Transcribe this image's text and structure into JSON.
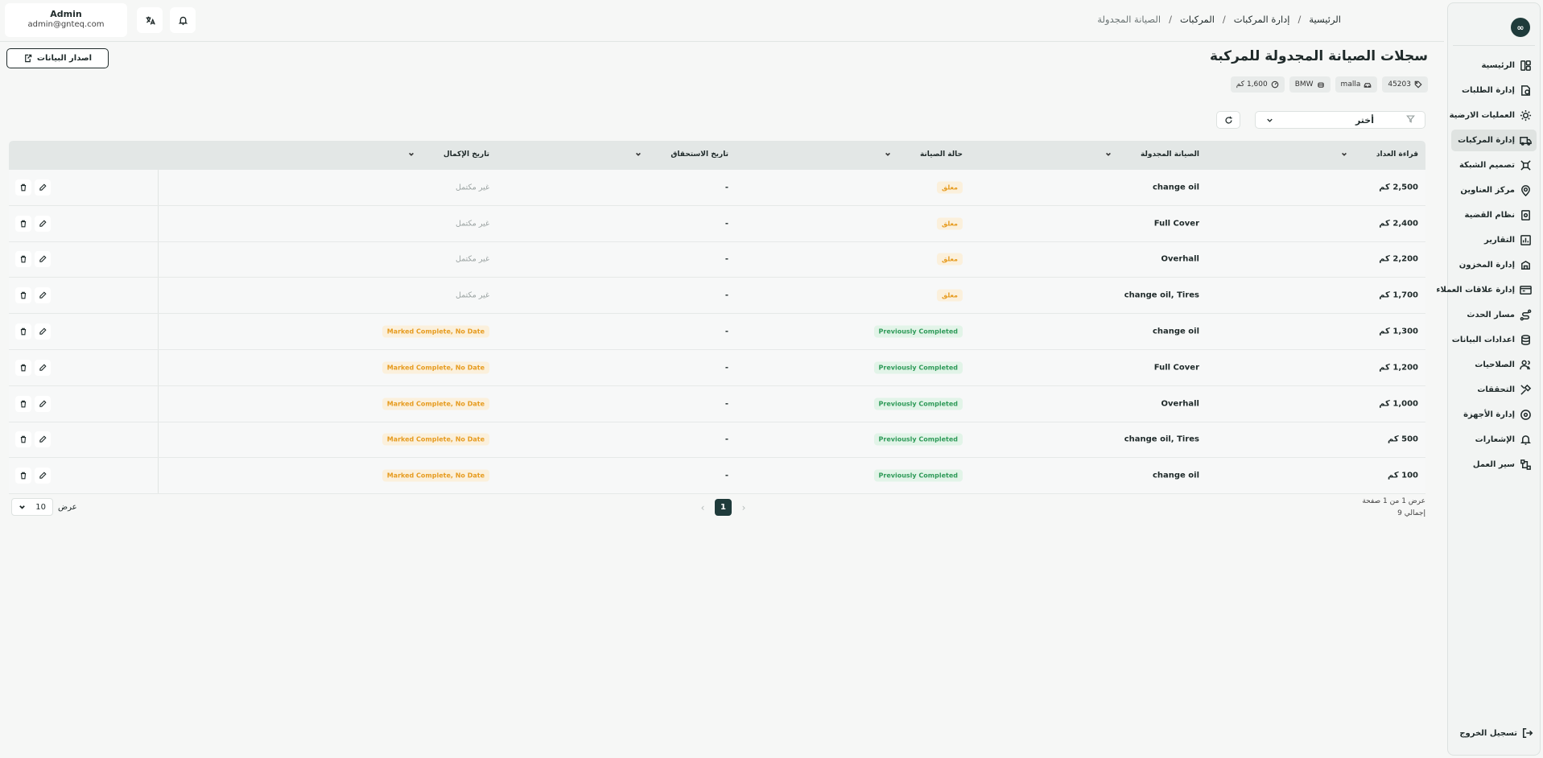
{
  "user": {
    "name": "Admin",
    "email": "admin@gnteq.com"
  },
  "breadcrumb": [
    "الرئيسية",
    "إدارة المركبات",
    "المركبات",
    "الصيانة المجدولة"
  ],
  "sidebar": {
    "items": [
      {
        "label": "الرئيسية",
        "icon": "dashboard-icon"
      },
      {
        "label": "إدارة الطلبات",
        "icon": "orders-icon"
      },
      {
        "label": "العمليات الارضية",
        "icon": "ground-ops-icon"
      },
      {
        "label": "إدارة المركبات",
        "icon": "vehicle-icon",
        "active": true
      },
      {
        "label": "تصميم الشبكة",
        "icon": "network-icon"
      },
      {
        "label": "مركز العناوين",
        "icon": "location-icon"
      },
      {
        "label": "نظام القضية",
        "icon": "case-icon"
      },
      {
        "label": "التقارير",
        "icon": "reports-icon"
      },
      {
        "label": "إدارة المخزون",
        "icon": "inventory-icon"
      },
      {
        "label": "إدارة علاقات العملاء",
        "icon": "crm-icon"
      },
      {
        "label": "مسار الحدث",
        "icon": "route-icon"
      },
      {
        "label": "اعدادات البيانات",
        "icon": "database-icon"
      },
      {
        "label": "الصلاحيات",
        "icon": "users-icon"
      },
      {
        "label": "التحققات",
        "icon": "tools-icon"
      },
      {
        "label": "إدارة الأجهزة",
        "icon": "device-icon"
      },
      {
        "label": "الإشعارات",
        "icon": "bell-icon"
      },
      {
        "label": "سير العمل",
        "icon": "workflow-icon"
      }
    ],
    "logout": "تسجيل الخروج"
  },
  "page": {
    "title": "سجلات الصيانة المجدولة للمركبة",
    "export_label": "اصدار البيانات",
    "chips": [
      {
        "text": "45203",
        "icon": "tag-icon"
      },
      {
        "text": "malla",
        "icon": "car-icon"
      },
      {
        "text": "BMW",
        "icon": "car-front-icon"
      },
      {
        "text": "1,600 كم",
        "icon": "gauge-icon"
      }
    ],
    "filter": {
      "selected": "أختر"
    }
  },
  "table": {
    "headers": [
      "قراءة العداد",
      "الصيانة المجدولة",
      "حالة الصيانة",
      "تاريخ الاستحقاق",
      "تاريخ الإكمال"
    ],
    "rows": [
      {
        "odometer": "2,500 كم",
        "maintenance": "change oil",
        "status": "معلق",
        "status_type": "pending",
        "due": "-",
        "completion": "غير مكتمل",
        "completion_type": "incomplete"
      },
      {
        "odometer": "2,400 كم",
        "maintenance": "Full Cover",
        "status": "معلق",
        "status_type": "pending",
        "due": "-",
        "completion": "غير مكتمل",
        "completion_type": "incomplete"
      },
      {
        "odometer": "2,200 كم",
        "maintenance": "Overhall",
        "status": "معلق",
        "status_type": "pending",
        "due": "-",
        "completion": "غير مكتمل",
        "completion_type": "incomplete"
      },
      {
        "odometer": "1,700 كم",
        "maintenance": "change oil, Tires",
        "status": "معلق",
        "status_type": "pending",
        "due": "-",
        "completion": "غير مكتمل",
        "completion_type": "incomplete"
      },
      {
        "odometer": "1,300 كم",
        "maintenance": "change oil",
        "status": "Previously Completed",
        "status_type": "completed",
        "due": "-",
        "completion": "Marked Complete, No Date",
        "completion_type": "nodate"
      },
      {
        "odometer": "1,200 كم",
        "maintenance": "Full Cover",
        "status": "Previously Completed",
        "status_type": "completed",
        "due": "-",
        "completion": "Marked Complete, No Date",
        "completion_type": "nodate"
      },
      {
        "odometer": "1,000 كم",
        "maintenance": "Overhall",
        "status": "Previously Completed",
        "status_type": "completed",
        "due": "-",
        "completion": "Marked Complete, No Date",
        "completion_type": "nodate"
      },
      {
        "odometer": "500 كم",
        "maintenance": "change oil, Tires",
        "status": "Previously Completed",
        "status_type": "completed",
        "due": "-",
        "completion": "Marked Complete, No Date",
        "completion_type": "nodate"
      },
      {
        "odometer": "100 كم",
        "maintenance": "change oil",
        "status": "Previously Completed",
        "status_type": "completed",
        "due": "-",
        "completion": "Marked Complete, No Date",
        "completion_type": "nodate"
      }
    ]
  },
  "pagination": {
    "page_info": "عرض 1 من 1 صفحة",
    "total": "إجمالي 9",
    "current_page": "1",
    "page_size": "10",
    "page_size_label": "عرض"
  },
  "colors": {
    "accent": "#1f3b3b",
    "pending": "#e69b1f",
    "completed": "#2e9a58"
  }
}
